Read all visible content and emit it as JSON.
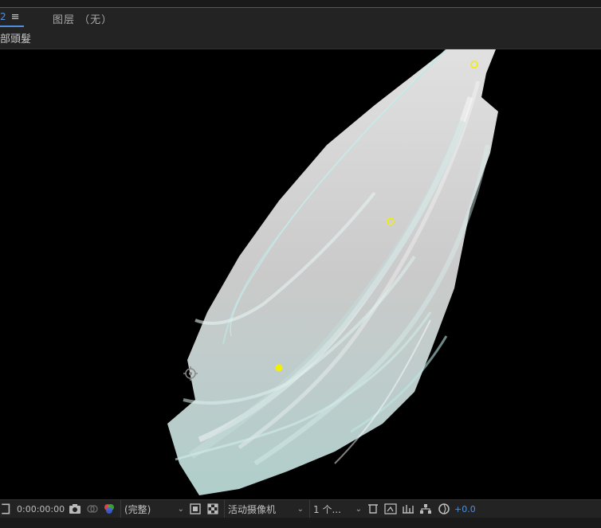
{
  "panel": {
    "tab_label": "2",
    "menu_glyph": "≡",
    "layer_label": "图层 （无）",
    "comp_name": "部頭髮"
  },
  "toolbar": {
    "timecode": "0:00:00:00",
    "resolution": "(完整)",
    "camera": "活动摄像机",
    "views": "1 个...",
    "exposure": "+0.0",
    "icons": [
      "region-icon",
      "camera-snapshot-icon",
      "show-snapshot-icon",
      "color-channels-icon",
      "toggle-mask-icon",
      "transparency-grid-icon",
      "3d-view-icon",
      "reset-exposure-icon"
    ]
  },
  "colors": {
    "accent": "#4f8fe0",
    "viewer_bg": "#000000",
    "panel_bg": "#232323",
    "control_point": "#f0f000"
  }
}
